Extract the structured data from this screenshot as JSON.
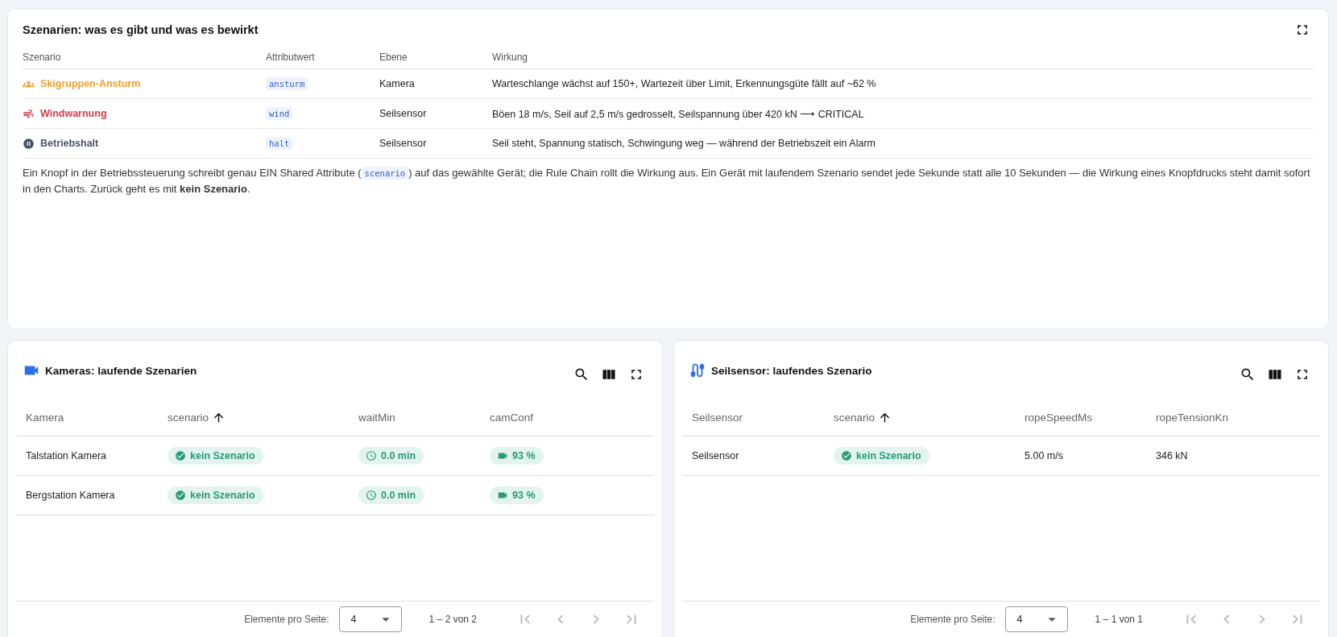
{
  "overview": {
    "title": "Szenarien: was es gibt und was es bewirkt",
    "columns": [
      "Szenario",
      "Attributwert",
      "Ebene",
      "Wirkung"
    ],
    "rows": [
      {
        "kind": "group",
        "name": "Skigruppen-Ansturm",
        "color": "#f0a030",
        "value": "ansturm",
        "layer": "Kamera",
        "effect": "Warteschlange wächst auf 150+, Wartezeit über Limit, Erkennungsgüte fällt auf ~62 %"
      },
      {
        "kind": "wind",
        "name": "Windwarnung",
        "color": "#d63a4a",
        "value": "wind",
        "layer": "Seilsensor",
        "effect": "Böen 18 m/s, Seil auf 2,5 m/s gedrosselt, Seilspannung über 420 kN ⟶ CRITICAL"
      },
      {
        "kind": "pause",
        "name": "Betriebshalt",
        "color": "#4a5468",
        "value": "halt",
        "layer": "Seilsensor",
        "effect": "Seil steht, Spannung statisch, Schwingung weg — während der Betriebszeit ein Alarm"
      }
    ],
    "note": [
      {
        "kind": "text",
        "text": "Ein Knopf in der Betriebssteuerung schreibt genau EIN Shared Attribute ("
      },
      {
        "kind": "code",
        "text": "scenario"
      },
      {
        "kind": "text",
        "text": ") auf das gewählte Gerät; die Rule Chain rollt die Wirkung aus. Ein Gerät mit laufendem Szenario sendet jede Sekunde statt alle 10 Sekunden — die Wirkung eines Knopfdrucks steht damit sofort in den Charts. Zurück geht es mit **kein Szenario**."
      }
    ]
  },
  "tables": [
    {
      "kind": "camera",
      "title": "Kameras: laufende Szenarien",
      "columns": [
        {
          "label": "Kamera",
          "sorted": false
        },
        {
          "label": "scenario",
          "sorted": true
        },
        {
          "label": "waitMin",
          "sorted": false
        },
        {
          "label": "camConf",
          "sorted": false
        }
      ],
      "rows": [
        [
          {
            "kind": "text",
            "text": "Talstation Kamera"
          },
          {
            "kind": "check",
            "text": "kein Szenario"
          },
          {
            "kind": "clock",
            "text": "0.0 min"
          },
          {
            "kind": "camera",
            "text": "93 %"
          }
        ],
        [
          {
            "kind": "text",
            "text": "Bergstation Kamera"
          },
          {
            "kind": "check",
            "text": "kein Szenario"
          },
          {
            "kind": "clock",
            "text": "0.0 min"
          },
          {
            "kind": "camera",
            "text": "93 %"
          }
        ]
      ],
      "paginator": {
        "label": "Elemente pro Seite:",
        "page_size": "4",
        "range": "1 – 2 von 2",
        "nav": [
          {
            "kind": "first",
            "disabled": true
          },
          {
            "kind": "prev",
            "disabled": true
          },
          {
            "kind": "next",
            "disabled": true
          },
          {
            "kind": "last",
            "disabled": true
          }
        ]
      }
    },
    {
      "kind": "cable",
      "title": "Seilsensor: laufendes Szenario",
      "columns": [
        {
          "label": "Seilsensor",
          "sorted": false
        },
        {
          "label": "scenario",
          "sorted": true
        },
        {
          "label": "ropeSpeedMs",
          "sorted": false
        },
        {
          "label": "ropeTensionKn",
          "sorted": false
        }
      ],
      "rows": [
        [
          {
            "kind": "text",
            "text": "Seilsensor"
          },
          {
            "kind": "check",
            "text": "kein Szenario"
          },
          {
            "kind": "text",
            "text": "5.00 m/s"
          },
          {
            "kind": "text",
            "text": "346 kN"
          }
        ]
      ],
      "paginator": {
        "label": "Elemente pro Seite:",
        "page_size": "4",
        "range": "1 – 1 von 1",
        "nav": [
          {
            "kind": "first",
            "disabled": true
          },
          {
            "kind": "prev",
            "disabled": true
          },
          {
            "kind": "next",
            "disabled": true
          },
          {
            "kind": "last",
            "disabled": true
          }
        ]
      }
    }
  ]
}
